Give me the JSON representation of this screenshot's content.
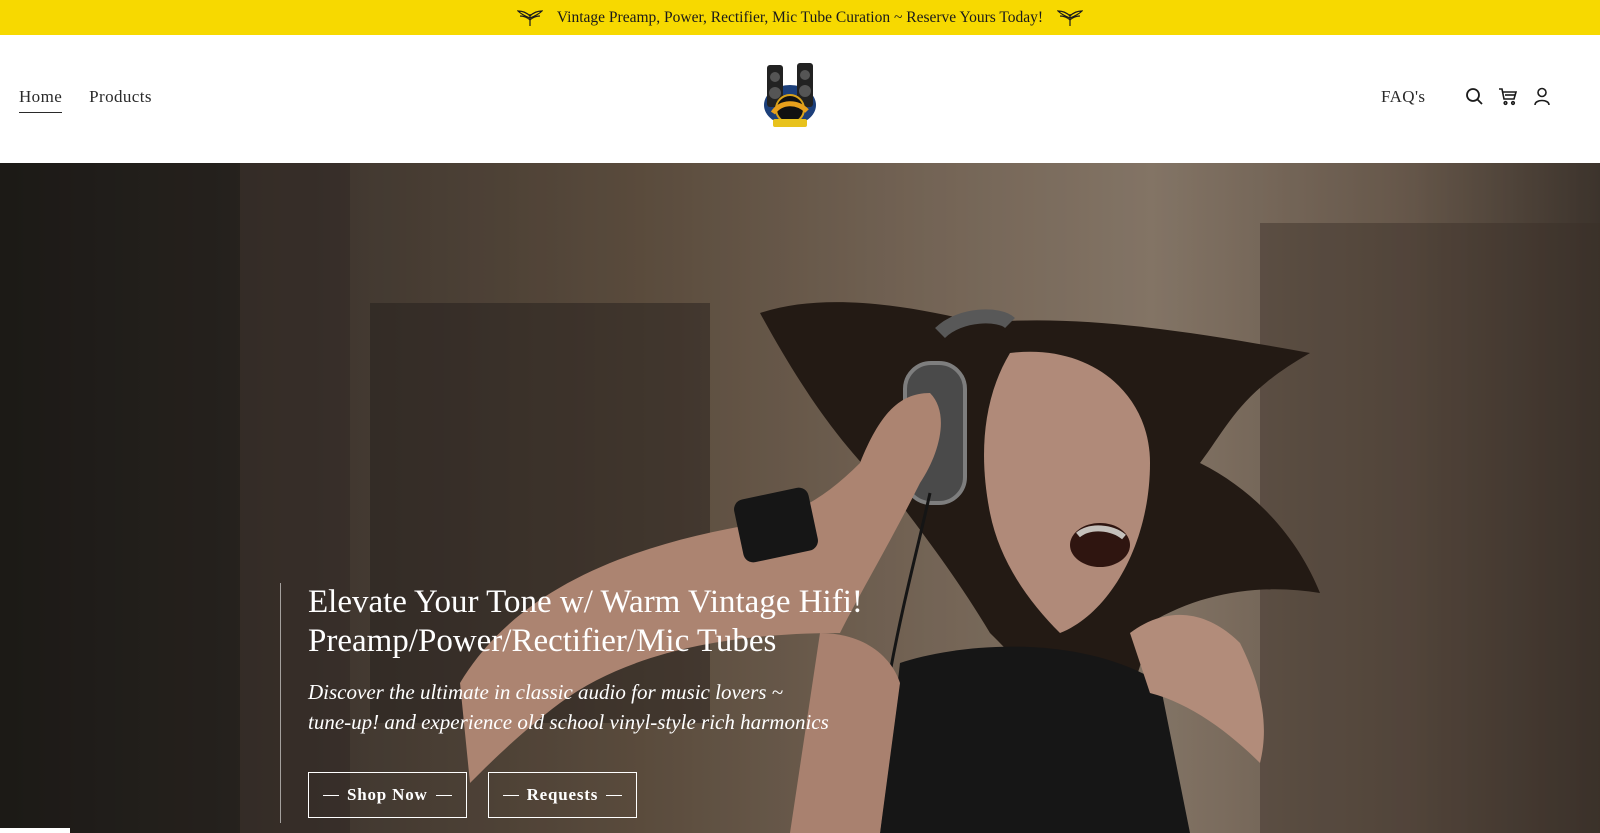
{
  "announcement": {
    "text": "Vintage Preamp, Power, Rectifier, Mic Tube Curation ~ Reserve Yours Today!"
  },
  "nav": {
    "left": [
      {
        "label": "Home",
        "active": true
      },
      {
        "label": "Products",
        "active": false
      }
    ],
    "right": [
      {
        "label": "FAQ's"
      }
    ]
  },
  "icons": {
    "search": "search-icon",
    "cart": "cart-icon",
    "account": "account-icon",
    "decor": "leaf-icon"
  },
  "hero": {
    "title_line1": "Elevate Your Tone w/ Warm Vintage Hifi!",
    "title_line2": "Preamp/Power/Rectifier/Mic Tubes",
    "subtitle_line1": "Discover the ultimate in classic audio for music lovers  ~",
    "subtitle_line2": "tune-up! and experience old school vinyl-style rich harmonics",
    "buttons": [
      {
        "label": "Shop Now"
      },
      {
        "label": "Requests"
      }
    ]
  },
  "colors": {
    "announce_bg": "#f7d900",
    "text": "#1b1b1b",
    "hero_text": "#ffffff"
  }
}
